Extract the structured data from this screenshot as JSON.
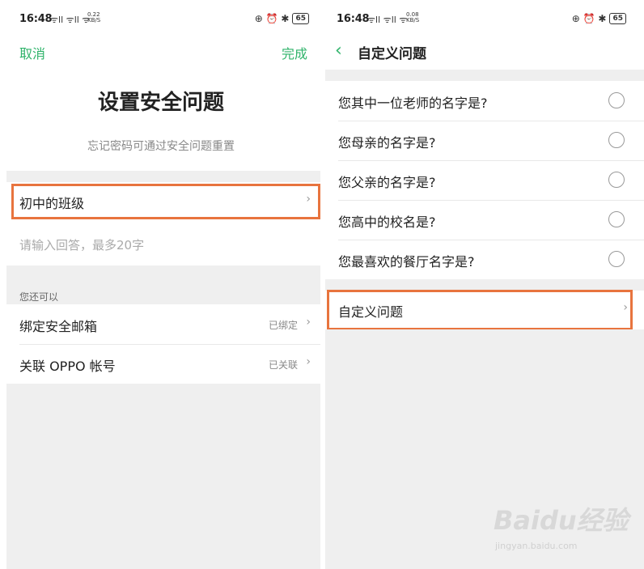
{
  "left_screen": {
    "status": {
      "time": "16:48",
      "signal": "ᯤll ᯤll ᯤ",
      "net_speed": "0.22",
      "net_unit": "KB/S",
      "icons": "⊕ ⏰ ✱",
      "battery": "65"
    },
    "cancel_label": "取消",
    "done_label": "完成",
    "title": "设置安全问题",
    "subtitle": "忘记密码可通过安全问题重置",
    "question_selected": "初中的班级",
    "answer_placeholder": "请输入回答，最多20字",
    "section_label": "您还可以",
    "bind_email_label": "绑定安全邮箱",
    "bind_email_status": "已绑定",
    "link_oppo_label": "关联 OPPO 帐号",
    "link_oppo_status": "已关联",
    "chevron": "›"
  },
  "right_screen": {
    "status": {
      "time": "16:48",
      "signal": "ᯤll ᯤll ᯤ",
      "net_speed": "0.08",
      "net_unit": "KB/S",
      "icons": "⊕ ⏰ ✱",
      "battery": "65"
    },
    "back_icon": "‹",
    "title": "自定义问题",
    "questions": [
      "您其中一位老师的名字是?",
      "您母亲的名字是?",
      "您父亲的名字是?",
      "您高中的校名是?",
      "您最喜欢的餐厅名字是?"
    ],
    "custom_question_label": "自定义问题",
    "chevron": "›"
  },
  "watermark": {
    "brand": "Baidu经验",
    "url": "jingyan.baidu.com"
  },
  "colors": {
    "accent": "#2fb36a",
    "highlight": "#e8743e",
    "background_gray": "#efefef"
  }
}
